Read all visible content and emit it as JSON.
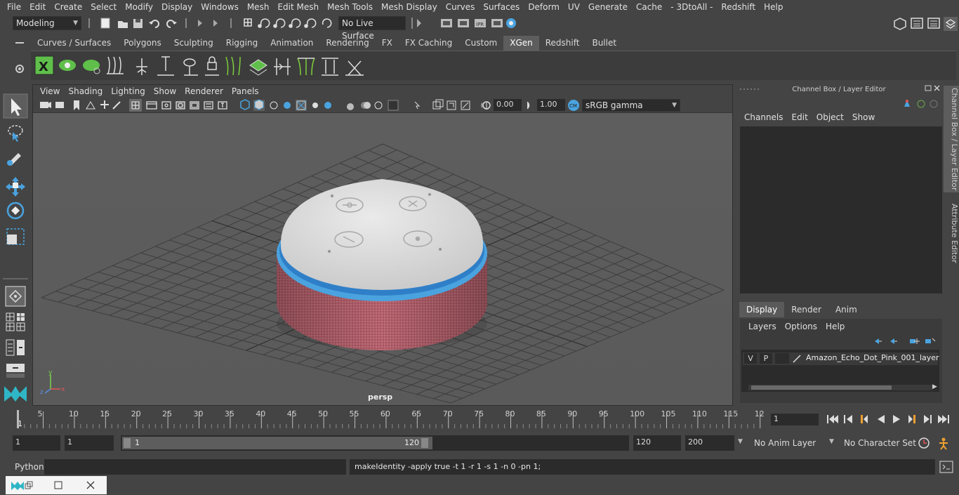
{
  "menubar": [
    "File",
    "Edit",
    "Create",
    "Select",
    "Modify",
    "Display",
    "Windows",
    "Mesh",
    "Edit Mesh",
    "Mesh Tools",
    "Mesh Display",
    "Curves",
    "Surfaces",
    "Deform",
    "UV",
    "Generate",
    "Cache",
    "- 3DtoAll -",
    "Redshift",
    "Help"
  ],
  "status": {
    "workspace": "Modeling",
    "live_surface": "No Live Surface"
  },
  "shelf_tabs": [
    "Curves / Surfaces",
    "Polygons",
    "Sculpting",
    "Rigging",
    "Animation",
    "Rendering",
    "FX",
    "FX Caching",
    "Custom",
    "XGen",
    "Redshift",
    "Bullet"
  ],
  "active_shelf_tab": "XGen",
  "viewport": {
    "menu": [
      "View",
      "Shading",
      "Lighting",
      "Show",
      "Renderer",
      "Panels"
    ],
    "exposure": "0.00",
    "gamma": "1.00",
    "color_space": "sRGB gamma",
    "camera": "persp"
  },
  "channel_box": {
    "title": "Channel Box / Layer Editor",
    "menu": [
      "Channels",
      "Edit",
      "Object",
      "Show"
    ]
  },
  "layer_editor": {
    "tabs": [
      "Display",
      "Render",
      "Anim"
    ],
    "active_tab": "Display",
    "menu": [
      "Layers",
      "Options",
      "Help"
    ],
    "layers": [
      {
        "v": "V",
        "p": "P",
        "name": "Amazon_Echo_Dot_Pink_001_layer"
      }
    ]
  },
  "side_tabs": [
    "Channel Box / Layer Editor",
    "Attribute Editor"
  ],
  "timeline": {
    "ticks": [
      "5",
      "10",
      "15",
      "20",
      "25",
      "30",
      "35",
      "40",
      "45",
      "50",
      "55",
      "60",
      "65",
      "70",
      "75",
      "80",
      "85",
      "90",
      "95",
      "100",
      "105",
      "110",
      "115",
      "12"
    ],
    "start_marker": "1",
    "current_frame": "1"
  },
  "range": {
    "start": "1",
    "playback_start": "1",
    "slider_start": "1",
    "slider_end": "120",
    "playback_end": "120",
    "end": "200",
    "anim_layer": "No Anim Layer",
    "character_set": "No Character Set"
  },
  "command": {
    "language": "Python",
    "last_result": "makeIdentity -apply true -t 1 -r 1 -s 1 -n 0 -pn 1;"
  },
  "colors": {
    "accent_blue": "#4aa3df",
    "shelf_green": "#5fbf4a",
    "active_tab": "#5d5d5d"
  }
}
